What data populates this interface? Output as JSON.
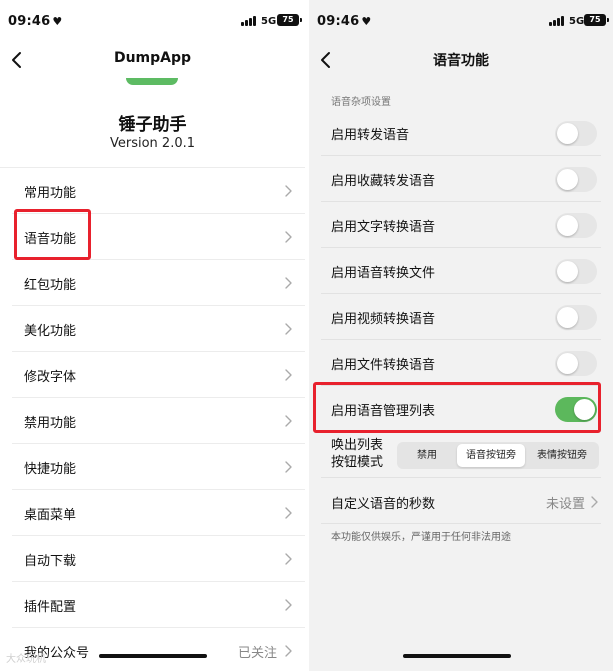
{
  "left": {
    "status": {
      "time": "09:46",
      "network": "5G",
      "battery": "75"
    },
    "nav": {
      "title": "DumpApp"
    },
    "app": {
      "name": "锤子助手",
      "version": "Version 2.0.1"
    },
    "menu": [
      {
        "label": "常用功能"
      },
      {
        "label": "语音功能"
      },
      {
        "label": "红包功能"
      },
      {
        "label": "美化功能"
      },
      {
        "label": "修改字体"
      },
      {
        "label": "禁用功能"
      },
      {
        "label": "快捷功能"
      },
      {
        "label": "桌面菜单"
      },
      {
        "label": "自动下载"
      },
      {
        "label": "插件配置"
      },
      {
        "label": "我的公众号",
        "value": "已关注"
      }
    ],
    "watermark": "大众玩机"
  },
  "right": {
    "status": {
      "time": "09:46",
      "network": "5G",
      "battery": "75"
    },
    "nav": {
      "title": "语音功能"
    },
    "section_header": "语音杂项设置",
    "switches": [
      {
        "label": "启用转发语音",
        "on": false
      },
      {
        "label": "启用收藏转发语音",
        "on": false
      },
      {
        "label": "启用文字转换语音",
        "on": false
      },
      {
        "label": "启用语音转换文件",
        "on": false
      },
      {
        "label": "启用视频转换语音",
        "on": false
      },
      {
        "label": "启用文件转换语音",
        "on": false
      },
      {
        "label": "启用语音管理列表",
        "on": true
      }
    ],
    "mode": {
      "label_line1": "唤出列表",
      "label_line2": "按钮模式",
      "options": [
        "禁用",
        "语音按钮旁",
        "表情按钮旁"
      ],
      "selected_index": 1
    },
    "seconds": {
      "label": "自定义语音的秒数",
      "value": "未设置"
    },
    "footnote": "本功能仅供娱乐，严谨用于任何非法用途"
  },
  "colors": {
    "highlight": "#e8212d",
    "toggle_on": "#5cb85c",
    "logo_green": "#5dbb63"
  },
  "icons": [
    "heart-icon",
    "signal-icon",
    "battery-icon",
    "back-chevron-icon",
    "chevron-right-icon"
  ]
}
